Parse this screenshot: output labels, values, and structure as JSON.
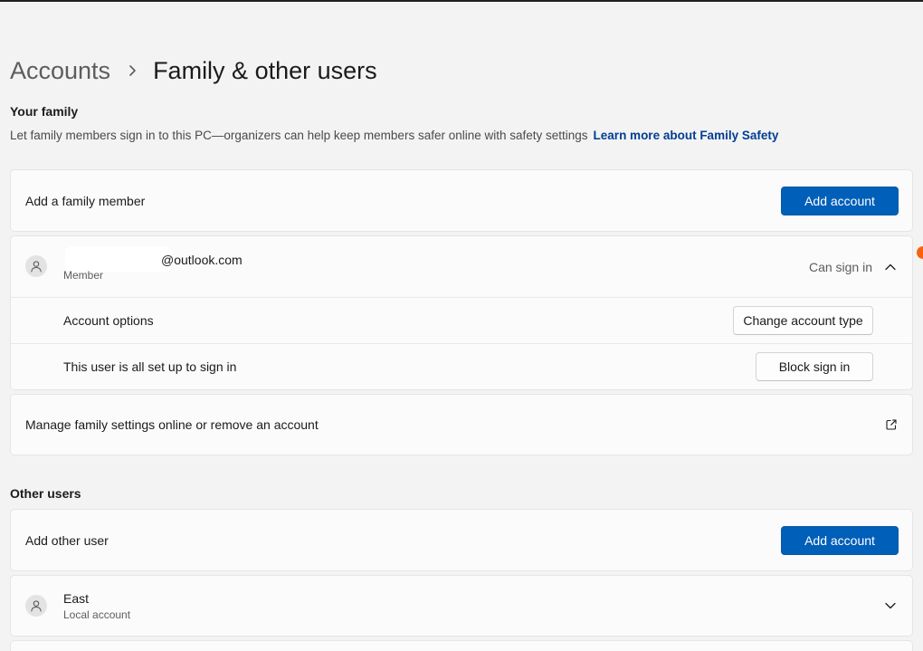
{
  "breadcrumb": {
    "parent": "Accounts",
    "current": "Family & other users"
  },
  "your_family": {
    "title": "Your family",
    "description": "Let family members sign in to this PC—organizers can help keep members safer online with safety settings",
    "learn_more": "Learn more about Family Safety",
    "add_member_label": "Add a family member",
    "add_account_button": "Add account"
  },
  "family_member": {
    "email_suffix": "@outlook.com",
    "role": "Member",
    "status": "Can sign in",
    "account_options_label": "Account options",
    "change_type_button": "Change account type",
    "signin_status_label": "This user is all set up to sign in",
    "block_button": "Block sign in"
  },
  "manage_family": {
    "label": "Manage family settings online or remove an account"
  },
  "other_users": {
    "title": "Other users",
    "add_label": "Add other user",
    "add_account_button": "Add account",
    "user": {
      "name": "East",
      "type": "Local account"
    }
  },
  "colors": {
    "accent": "#005fb8",
    "link": "#003e92",
    "notification": "#f7630c"
  },
  "icons": {
    "breadcrumb_separator": "chevron-right-icon",
    "avatar": "person-icon",
    "expanded": "chevron-up-icon",
    "collapsed": "chevron-down-icon",
    "external": "open-in-new-icon"
  }
}
